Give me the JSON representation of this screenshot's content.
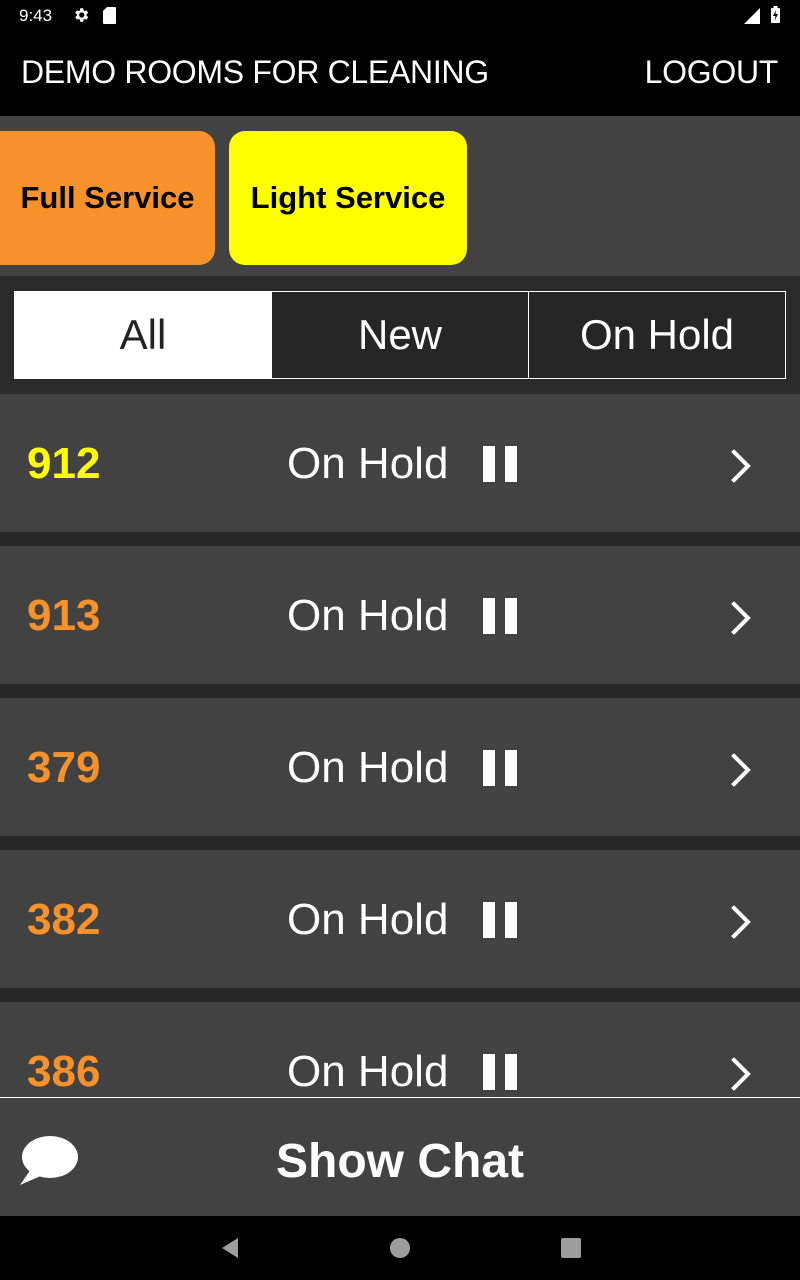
{
  "status_bar": {
    "time": "9:43",
    "icons": [
      "gear-icon",
      "sd-card-icon",
      "signal-icon",
      "battery-charging-icon"
    ]
  },
  "app_bar": {
    "title": "DEMO ROOMS FOR CLEANING",
    "logout_label": "LOGOUT"
  },
  "service_buttons": [
    {
      "label": "Full Service",
      "color": "#f7922b"
    },
    {
      "label": "Light Service",
      "color": "#ffff00"
    }
  ],
  "filter_tabs": [
    {
      "label": "All",
      "selected": true
    },
    {
      "label": "New",
      "selected": false
    },
    {
      "label": "On Hold",
      "selected": false
    }
  ],
  "rooms": [
    {
      "number": "912",
      "status": "On Hold",
      "number_color": "#ffff00",
      "status_icon": "pause-icon"
    },
    {
      "number": "913",
      "status": "On Hold",
      "number_color": "#f7922b",
      "status_icon": "pause-icon"
    },
    {
      "number": "379",
      "status": "On Hold",
      "number_color": "#f7922b",
      "status_icon": "pause-icon"
    },
    {
      "number": "382",
      "status": "On Hold",
      "number_color": "#f7922b",
      "status_icon": "pause-icon"
    },
    {
      "number": "386",
      "status": "On Hold",
      "number_color": "#f7922b",
      "status_icon": "pause-icon"
    }
  ],
  "chat_bar": {
    "label": "Show Chat",
    "icon": "chat-bubble-icon"
  },
  "nav_bar": {
    "buttons": [
      "back-icon",
      "home-icon",
      "recents-icon"
    ]
  }
}
